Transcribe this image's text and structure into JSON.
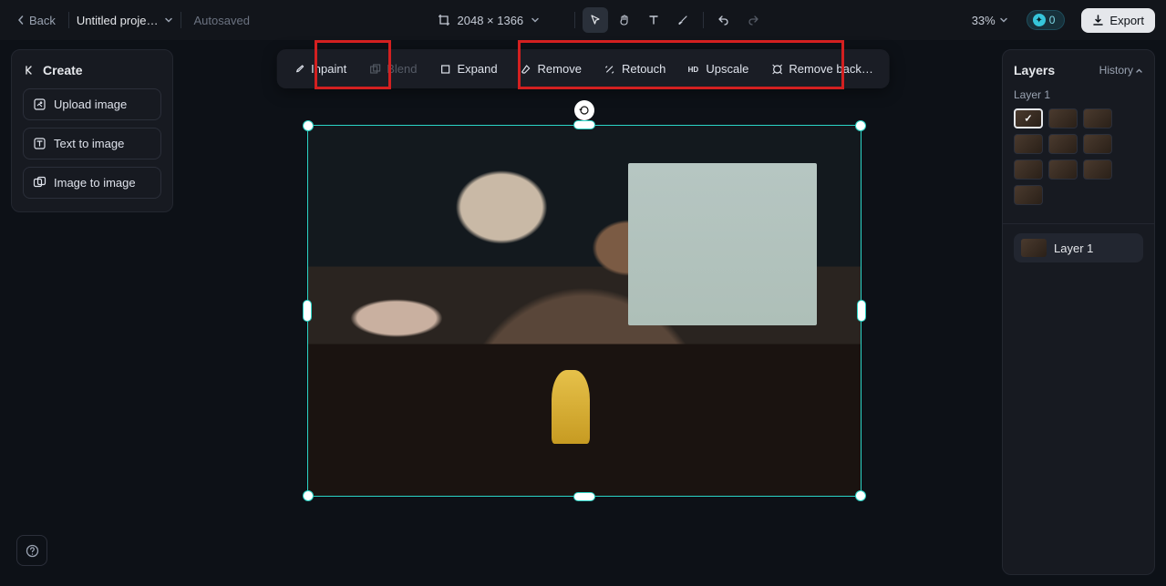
{
  "topbar": {
    "back": "Back",
    "title": "Untitled proje…",
    "autosaved": "Autosaved",
    "dimensions": "2048 × 1366",
    "zoom": "33%",
    "credits": "0",
    "export": "Export"
  },
  "create": {
    "header": "Create",
    "upload": "Upload image",
    "text2img": "Text to image",
    "img2img": "Image to image"
  },
  "ctx": {
    "inpaint": "Inpaint",
    "blend": "Blend",
    "expand": "Expand",
    "remove": "Remove",
    "retouch": "Retouch",
    "upscale": "Upscale",
    "removebg": "Remove back…"
  },
  "right": {
    "layers": "Layers",
    "history": "History",
    "layer1_label": "Layer 1",
    "thumbs_count": 10,
    "active_layer": "Layer 1"
  }
}
